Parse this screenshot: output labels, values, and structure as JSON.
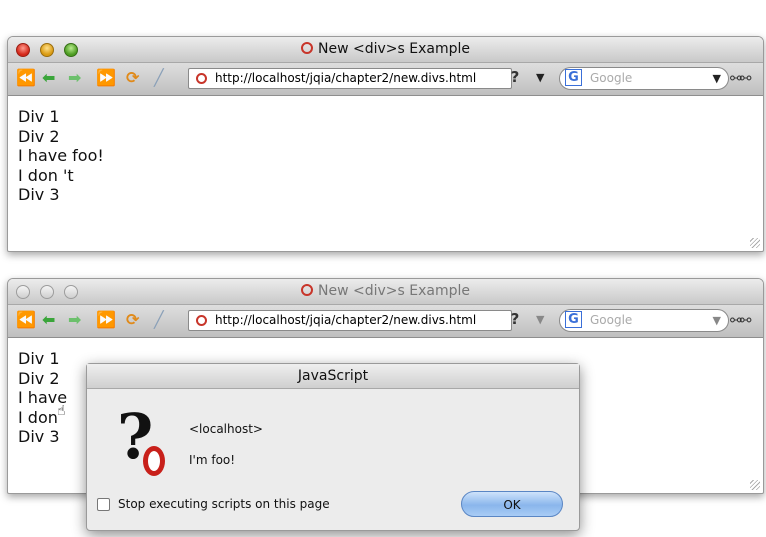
{
  "window1": {
    "title": "New <div>s Example",
    "url": "http://localhost/jqia/chapter2/new.divs.html",
    "search_placeholder": "Google",
    "lines": [
      "Div 1",
      "Div 2",
      "I have foo!",
      "I don 't",
      "Div 3"
    ]
  },
  "window2": {
    "title": "New <div>s Example",
    "url": "http://localhost/jqia/chapter2/new.divs.html",
    "search_placeholder": "Google",
    "lines": [
      "Div 1",
      "Div 2",
      "I have",
      "I don",
      "Div 3"
    ]
  },
  "dialog": {
    "title": "JavaScript",
    "host": "<localhost>",
    "message": "I'm foo!",
    "checkbox_label": "Stop executing scripts on this page",
    "ok_label": "OK"
  },
  "icons": {
    "back": "back-arrow-icon",
    "forward": "forward-arrow-icon",
    "reload": "reload-icon",
    "stop": "stop-icon",
    "page": "opera-page-icon",
    "search": "google-search-icon",
    "glasses": "glasses-icon",
    "question": "question-icon"
  },
  "colors": {
    "close": "#d4281a",
    "minimize": "#d99a12",
    "maximize": "#4d9c22",
    "ok_button": "#8ab6ec",
    "opera_red": "#c8201a"
  }
}
